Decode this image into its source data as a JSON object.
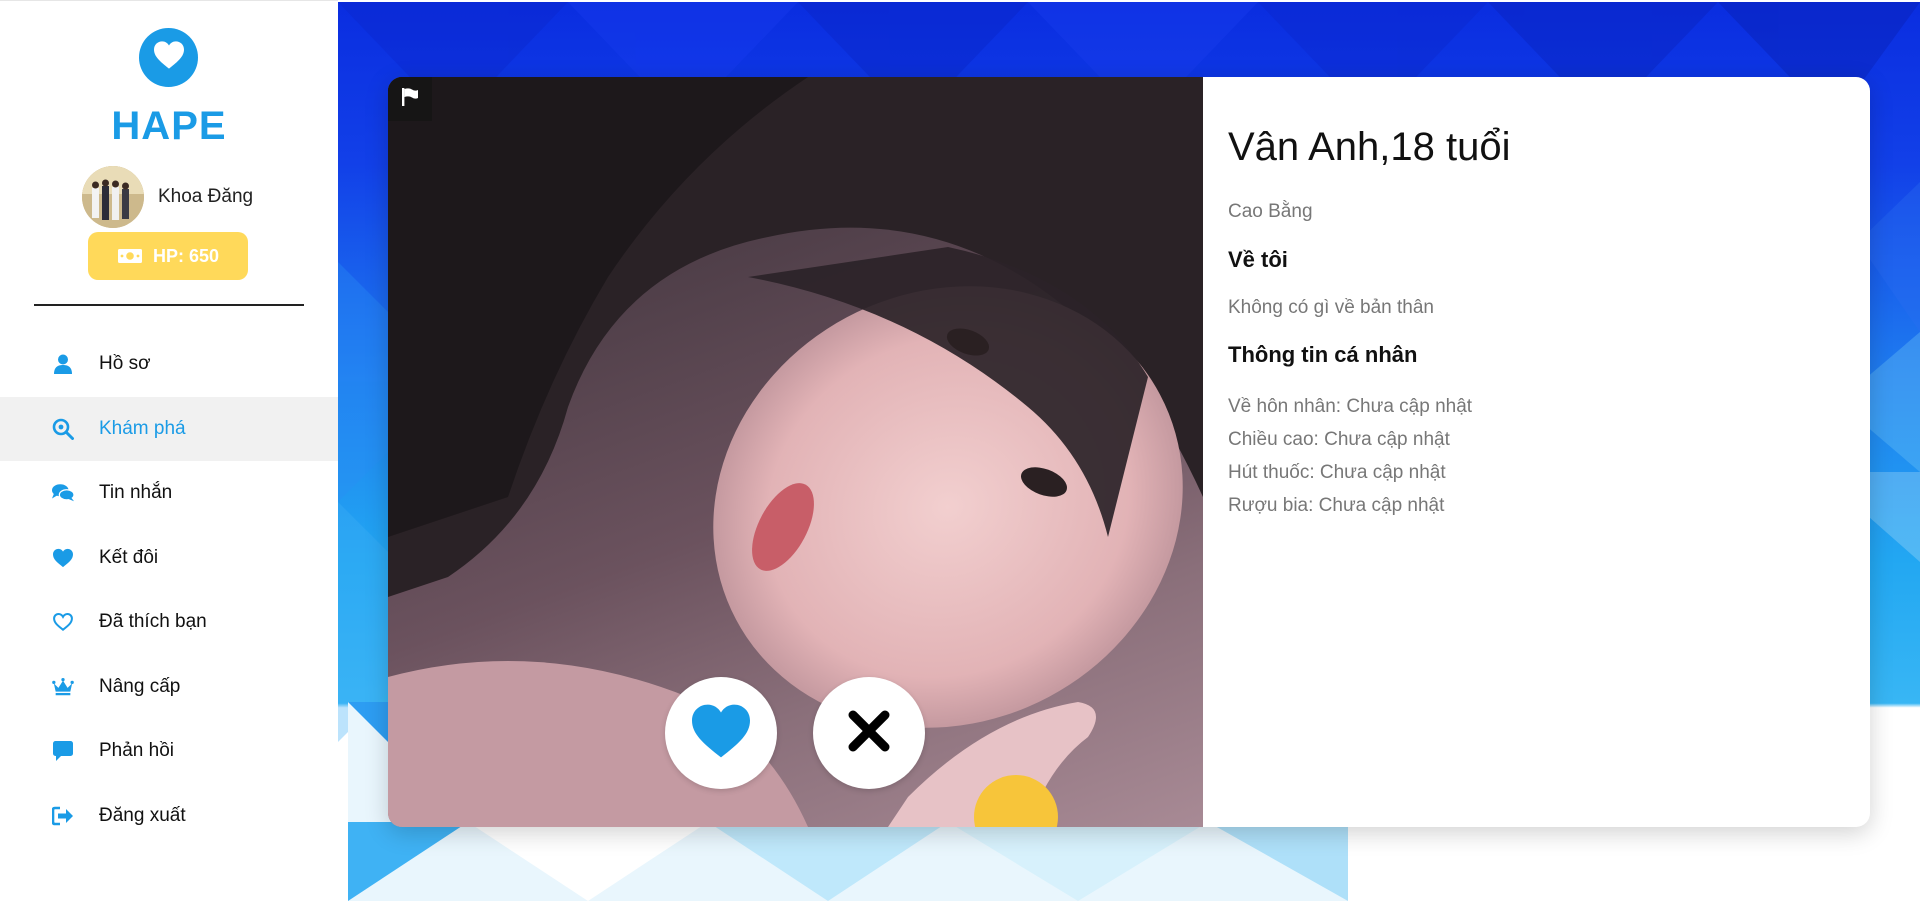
{
  "brand": {
    "name": "HAPE",
    "logo_icon": "heart-icon",
    "color": "#1a9be6"
  },
  "user": {
    "name": "Khoa Đăng",
    "hp_label": "HP: 650",
    "hp_icon": "money-icon",
    "hp_color": "#ffd95a"
  },
  "nav": [
    {
      "label": "Hồ sơ",
      "icon": "user-icon",
      "active": false
    },
    {
      "label": "Khám phá",
      "icon": "search-icon",
      "active": true
    },
    {
      "label": "Tin nhắn",
      "icon": "comments-icon",
      "active": false
    },
    {
      "label": "Kết đôi",
      "icon": "heart-icon",
      "active": false
    },
    {
      "label": "Đã thích bạn",
      "icon": "heart-outline-icon",
      "active": false
    },
    {
      "label": "Nâng cấp",
      "icon": "crown-icon",
      "active": false
    },
    {
      "label": "Phản hồi",
      "icon": "comment-icon",
      "active": false
    },
    {
      "label": "Đăng xuất",
      "icon": "sign-out-icon",
      "active": false
    }
  ],
  "profile": {
    "name_age": "Vân Anh,18 tuổi",
    "location": "Cao Bằng",
    "about_heading": "Về tôi",
    "about_text": "Không có gì về bản thân",
    "personal_heading": "Thông tin cá nhân",
    "details": [
      "Về hôn nhân: Chưa cập nhật",
      "Chiều cao: Chưa cập nhật",
      "Hút thuốc: Chưa cập nhật",
      "Rượu bia: Chưa cập nhật"
    ]
  },
  "actions": {
    "like_icon": "heart-icon",
    "dislike_icon": "close-icon",
    "report_icon": "flag-icon"
  }
}
